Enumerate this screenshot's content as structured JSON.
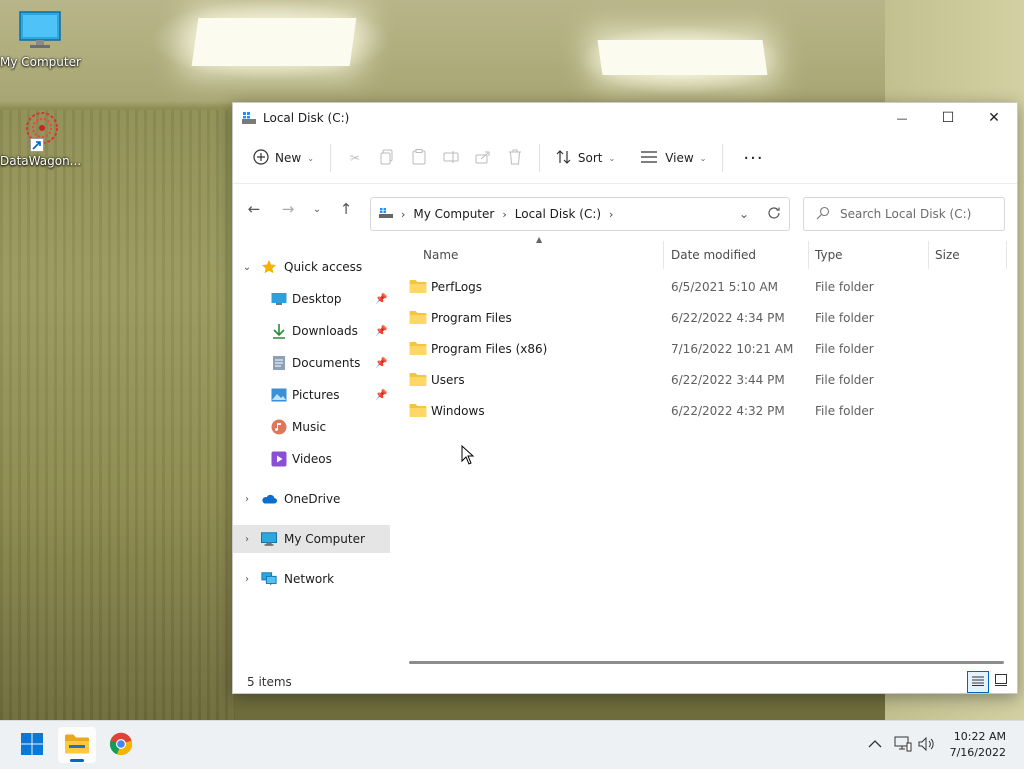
{
  "desktop": {
    "icons": [
      {
        "label": "My Computer"
      },
      {
        "label": "DataWagon..."
      }
    ]
  },
  "window": {
    "title": "Local Disk (C:)",
    "controls": {
      "minimize": "—",
      "maximize": "☐",
      "close": "✕"
    },
    "toolbar": {
      "new_label": "New",
      "sort_label": "Sort",
      "view_label": "View",
      "more_label": "···"
    },
    "breadcrumbs": [
      "My Computer",
      "Local Disk (C:)"
    ],
    "search": {
      "placeholder": "Search Local Disk (C:)"
    },
    "sidebar": {
      "quick_access": "Quick access",
      "pinned": [
        {
          "label": "Desktop",
          "icon": "desktop-icon"
        },
        {
          "label": "Downloads",
          "icon": "download-icon"
        },
        {
          "label": "Documents",
          "icon": "documents-icon"
        },
        {
          "label": "Pictures",
          "icon": "pictures-icon"
        },
        {
          "label": "Music",
          "icon": "music-icon"
        },
        {
          "label": "Videos",
          "icon": "videos-icon"
        }
      ],
      "onedrive": "OneDrive",
      "my_computer": "My Computer",
      "network": "Network"
    },
    "columns": {
      "name": "Name",
      "date": "Date modified",
      "type": "Type",
      "size": "Size"
    },
    "files": [
      {
        "name": "PerfLogs",
        "date": "6/5/2021 5:10 AM",
        "type": "File folder"
      },
      {
        "name": "Program Files",
        "date": "6/22/2022 4:34 PM",
        "type": "File folder"
      },
      {
        "name": "Program Files (x86)",
        "date": "7/16/2022 10:21 AM",
        "type": "File folder"
      },
      {
        "name": "Users",
        "date": "6/22/2022 3:44 PM",
        "type": "File folder"
      },
      {
        "name": "Windows",
        "date": "6/22/2022 4:32 PM",
        "type": "File folder"
      }
    ],
    "status": "5 items"
  },
  "taskbar": {
    "time": "10:22 AM",
    "date": "7/16/2022"
  },
  "colors": {
    "accent": "#0067c0",
    "folder": "#f4c542",
    "selection": "#e5e5e5"
  }
}
